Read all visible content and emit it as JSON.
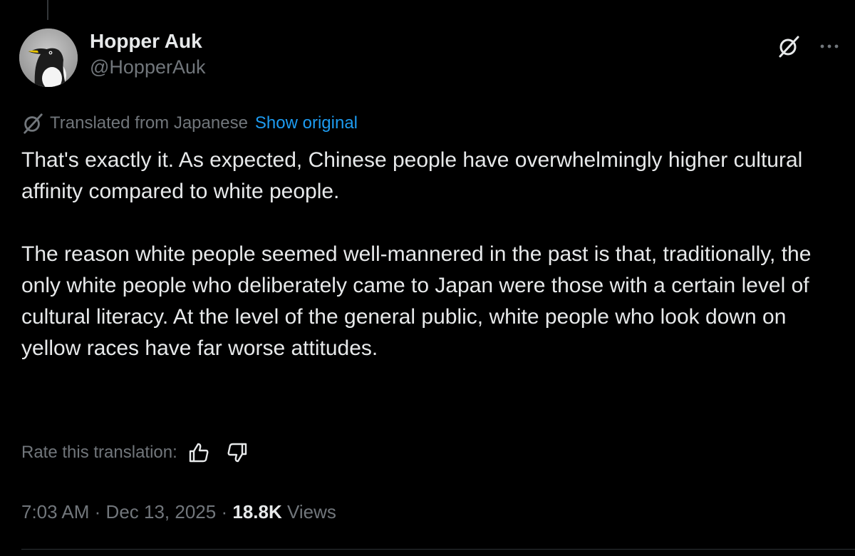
{
  "tweet": {
    "author": {
      "display_name": "Hopper Auk",
      "handle": "@HopperAuk"
    },
    "translation": {
      "label": "Translated from Japanese",
      "show_original": "Show original",
      "icon": "translate-icon"
    },
    "body": [
      "That's exactly it. As expected, Chinese people have overwhelmingly higher cultural affinity compared to white people.",
      "The reason white people seemed well-mannered in the past is that, traditionally, the only white people who deliberately came to Japan were those with a certain level of cultural literacy. At the level of the general public, white people who look down on yellow races have far worse attitudes."
    ],
    "rate_translation": {
      "label": "Rate this translation:",
      "up_icon": "thumbs-up-icon",
      "down_icon": "thumbs-down-icon"
    },
    "meta": {
      "time": "7:03 AM",
      "separator": "·",
      "date": "Dec 13, 2025",
      "views_count": "18.8K",
      "views_label": "Views"
    },
    "actions": {
      "grok_icon": "grok-icon",
      "more_icon": "more-icon"
    }
  },
  "colors": {
    "background": "#000000",
    "text_primary": "#e7e9ea",
    "text_secondary": "#71767b",
    "link": "#1d9bf0"
  }
}
